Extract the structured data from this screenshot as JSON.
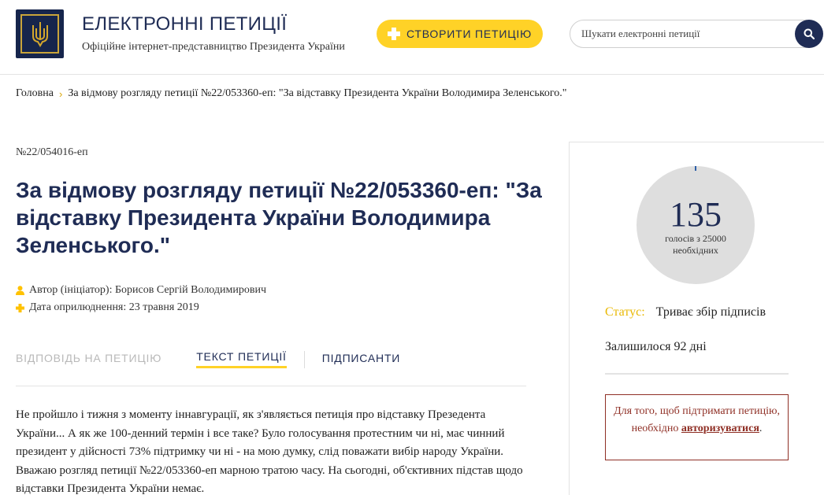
{
  "header": {
    "title": "ЕЛЕКТРОННІ ПЕТИЦІЇ",
    "subtitle": "Офіційне інтернет-представництво Президента України",
    "create_button": "СТВОРИТИ ПЕТИЦІЮ",
    "search_placeholder": "Шукати електронні петиції"
  },
  "breadcrumb": {
    "home": "Головна",
    "current": "За відмову розгляду петиції №22/053360-еп: \"За відставку Президента України Володимира Зеленського.\""
  },
  "petition": {
    "number": "№22/054016-еп",
    "title": "За відмову розгляду петиції №22/053360-еп: \"За відставку Президента України Володимира Зеленського.\"",
    "author": "Автор (ініціатор): Борисов Сергій Володимирович",
    "date": "Дата оприлюднення: 23 травня 2019",
    "tabs": {
      "answer": "ВІДПОВІДЬ НА ПЕТИЦІЮ",
      "text": "ТЕКСТ ПЕТИЦІЇ",
      "signers": "ПІДПИСАНТИ"
    },
    "body": "Не пройшло і тижня з моменту іннавгурації, як з'являється петиція про відставку Презедента України... А як же 100-денний термін і все таке? Було голосування протестним чи ні, має чинний президент у дійсності 73% підтримку чи ні - на мою думку, слід поважати вибір народу України. Вважаю розгляд петиції №22/053360-еп марною тратою часу. На сьогодні, об'єктивних підстав щодо відставки Президента України немає."
  },
  "sidebar": {
    "votes": "135",
    "votes_label": "голосів з 25000 необхідних",
    "votes_progress": 0.0054,
    "status_label": "Статус:",
    "status_value": "Триває збір підписів",
    "remaining": "Залишилося 92 дні",
    "auth_text": "Для того, щоб підтримати петицію, необхідно",
    "auth_link": "авторизуватися",
    "auth_dot": "."
  },
  "colors": {
    "navy": "#1f2c55",
    "yellow": "#ffd227",
    "status_yellow": "#e9b800",
    "auth_red": "#8f2f25"
  }
}
